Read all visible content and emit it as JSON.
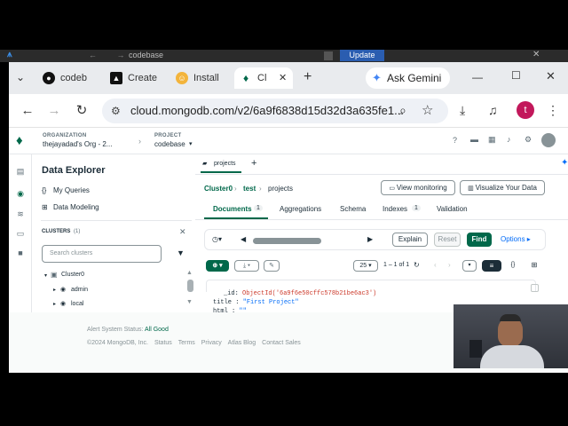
{
  "topbar": {
    "search_text": "codebase",
    "update_label": "Update"
  },
  "browser": {
    "tabs": [
      {
        "label": "codeb"
      },
      {
        "label": "Create"
      },
      {
        "label": "Install"
      },
      {
        "label": "Cl"
      }
    ],
    "new_tab": "+",
    "url": "cloud.mongodb.com/v2/6a9f6838d15d32d3a635fe1...",
    "ask_gemini": "Ask Gemini",
    "avatar_letter": "t"
  },
  "atlas": {
    "org_heading": "ORGANIZATION",
    "org_name": "thejayadad's Org - 2...",
    "project_heading": "PROJECT",
    "project_name": "codebase",
    "explorer_title": "Data Explorer",
    "my_queries": "My Queries",
    "data_modeling": "Data Modeling",
    "clusters_heading": "CLUSTERS",
    "clusters_count": "(1)",
    "search_placeholder": "Search clusters",
    "tree": {
      "cluster": "Cluster0",
      "db1": "admin",
      "db2": "local"
    },
    "workspace_tab": "projects",
    "breadcrumb": [
      "Cluster0",
      "test",
      "projects"
    ],
    "view_monitoring": "View monitoring",
    "visualize": "Visualize Your Data",
    "subtabs": [
      {
        "label": "Documents",
        "count": "1"
      },
      {
        "label": "Aggregations",
        "count": ""
      },
      {
        "label": "Schema",
        "count": ""
      },
      {
        "label": "Indexes",
        "count": "1"
      },
      {
        "label": "Validation",
        "count": ""
      }
    ],
    "explain": "Explain",
    "reset": "Reset",
    "find": "Find",
    "options": "Options ▸",
    "page_size": "25",
    "pagination": "1 – 1 of 1",
    "document": {
      "id_key": "_id",
      "id_val": "ObjectId('6a9f6e50cffc578b21be6ac3')",
      "title_key": "title",
      "title_val": "\"First Project\"",
      "html_key": "html",
      "html_val": "\"\""
    },
    "footer": {
      "status_prefix": "Alert System Status:",
      "status_value": "All Good",
      "copyright": "©2024 MongoDB, Inc.",
      "links": [
        "Status",
        "Terms",
        "Privacy",
        "Atlas Blog",
        "Contact Sales"
      ]
    }
  },
  "colors": {
    "brand_green": "#00684a",
    "link_blue": "#016bf8",
    "gemini_blue": "#4285f4",
    "update_blue": "#2a5db0"
  }
}
